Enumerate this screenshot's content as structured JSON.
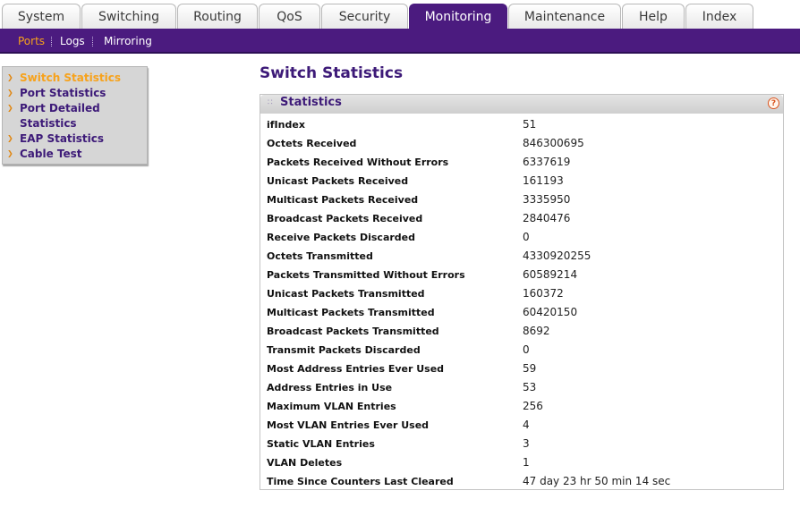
{
  "top_tabs": [
    "System",
    "Switching",
    "Routing",
    "QoS",
    "Security",
    "Monitoring",
    "Maintenance",
    "Help",
    "Index"
  ],
  "active_tab": "Monitoring",
  "sub_nav": [
    "Ports",
    "Logs",
    "Mirroring"
  ],
  "active_sub_nav": "Ports",
  "left_menu": [
    {
      "label": "Switch Statistics",
      "active": true
    },
    {
      "label": "Port Statistics",
      "active": false
    },
    {
      "label": "Port Detailed",
      "active": false
    },
    {
      "label": "Statistics",
      "active": false
    },
    {
      "label": "EAP Statistics",
      "active": false
    },
    {
      "label": "Cable Test",
      "active": false
    }
  ],
  "page_title": "Switch Statistics",
  "panel": {
    "title": "Statistics",
    "help_glyph": "?",
    "rows": [
      {
        "label": "ifIndex",
        "value": "51"
      },
      {
        "label": "Octets Received",
        "value": "846300695"
      },
      {
        "label": "Packets Received Without Errors",
        "value": "6337619"
      },
      {
        "label": "Unicast Packets Received",
        "value": "161193"
      },
      {
        "label": "Multicast Packets Received",
        "value": "3335950"
      },
      {
        "label": "Broadcast Packets Received",
        "value": "2840476"
      },
      {
        "label": "Receive Packets Discarded",
        "value": "0"
      },
      {
        "label": "Octets Transmitted",
        "value": "4330920255"
      },
      {
        "label": "Packets Transmitted Without Errors",
        "value": "60589214"
      },
      {
        "label": "Unicast Packets Transmitted",
        "value": "160372"
      },
      {
        "label": "Multicast Packets Transmitted",
        "value": "60420150"
      },
      {
        "label": "Broadcast Packets Transmitted",
        "value": "8692"
      },
      {
        "label": "Transmit Packets Discarded",
        "value": "0"
      },
      {
        "label": "Most Address Entries Ever Used",
        "value": "59"
      },
      {
        "label": "Address Entries in Use",
        "value": "53"
      },
      {
        "label": "Maximum VLAN Entries",
        "value": "256"
      },
      {
        "label": "Most VLAN Entries Ever Used",
        "value": "4"
      },
      {
        "label": "Static VLAN Entries",
        "value": "3"
      },
      {
        "label": "VLAN Deletes",
        "value": "1"
      },
      {
        "label": "Time Since Counters Last Cleared",
        "value": "47 day 23 hr 50 min 14 sec"
      }
    ]
  },
  "icons": {
    "menu_bullet": "menu-arrow-icon",
    "panel_grip": "drag-grip-icon",
    "help": "help-icon"
  },
  "colors": {
    "brand_purple": "#4b1b7f",
    "accent_orange": "#f7a21b",
    "title_purple": "#3d1a78"
  }
}
